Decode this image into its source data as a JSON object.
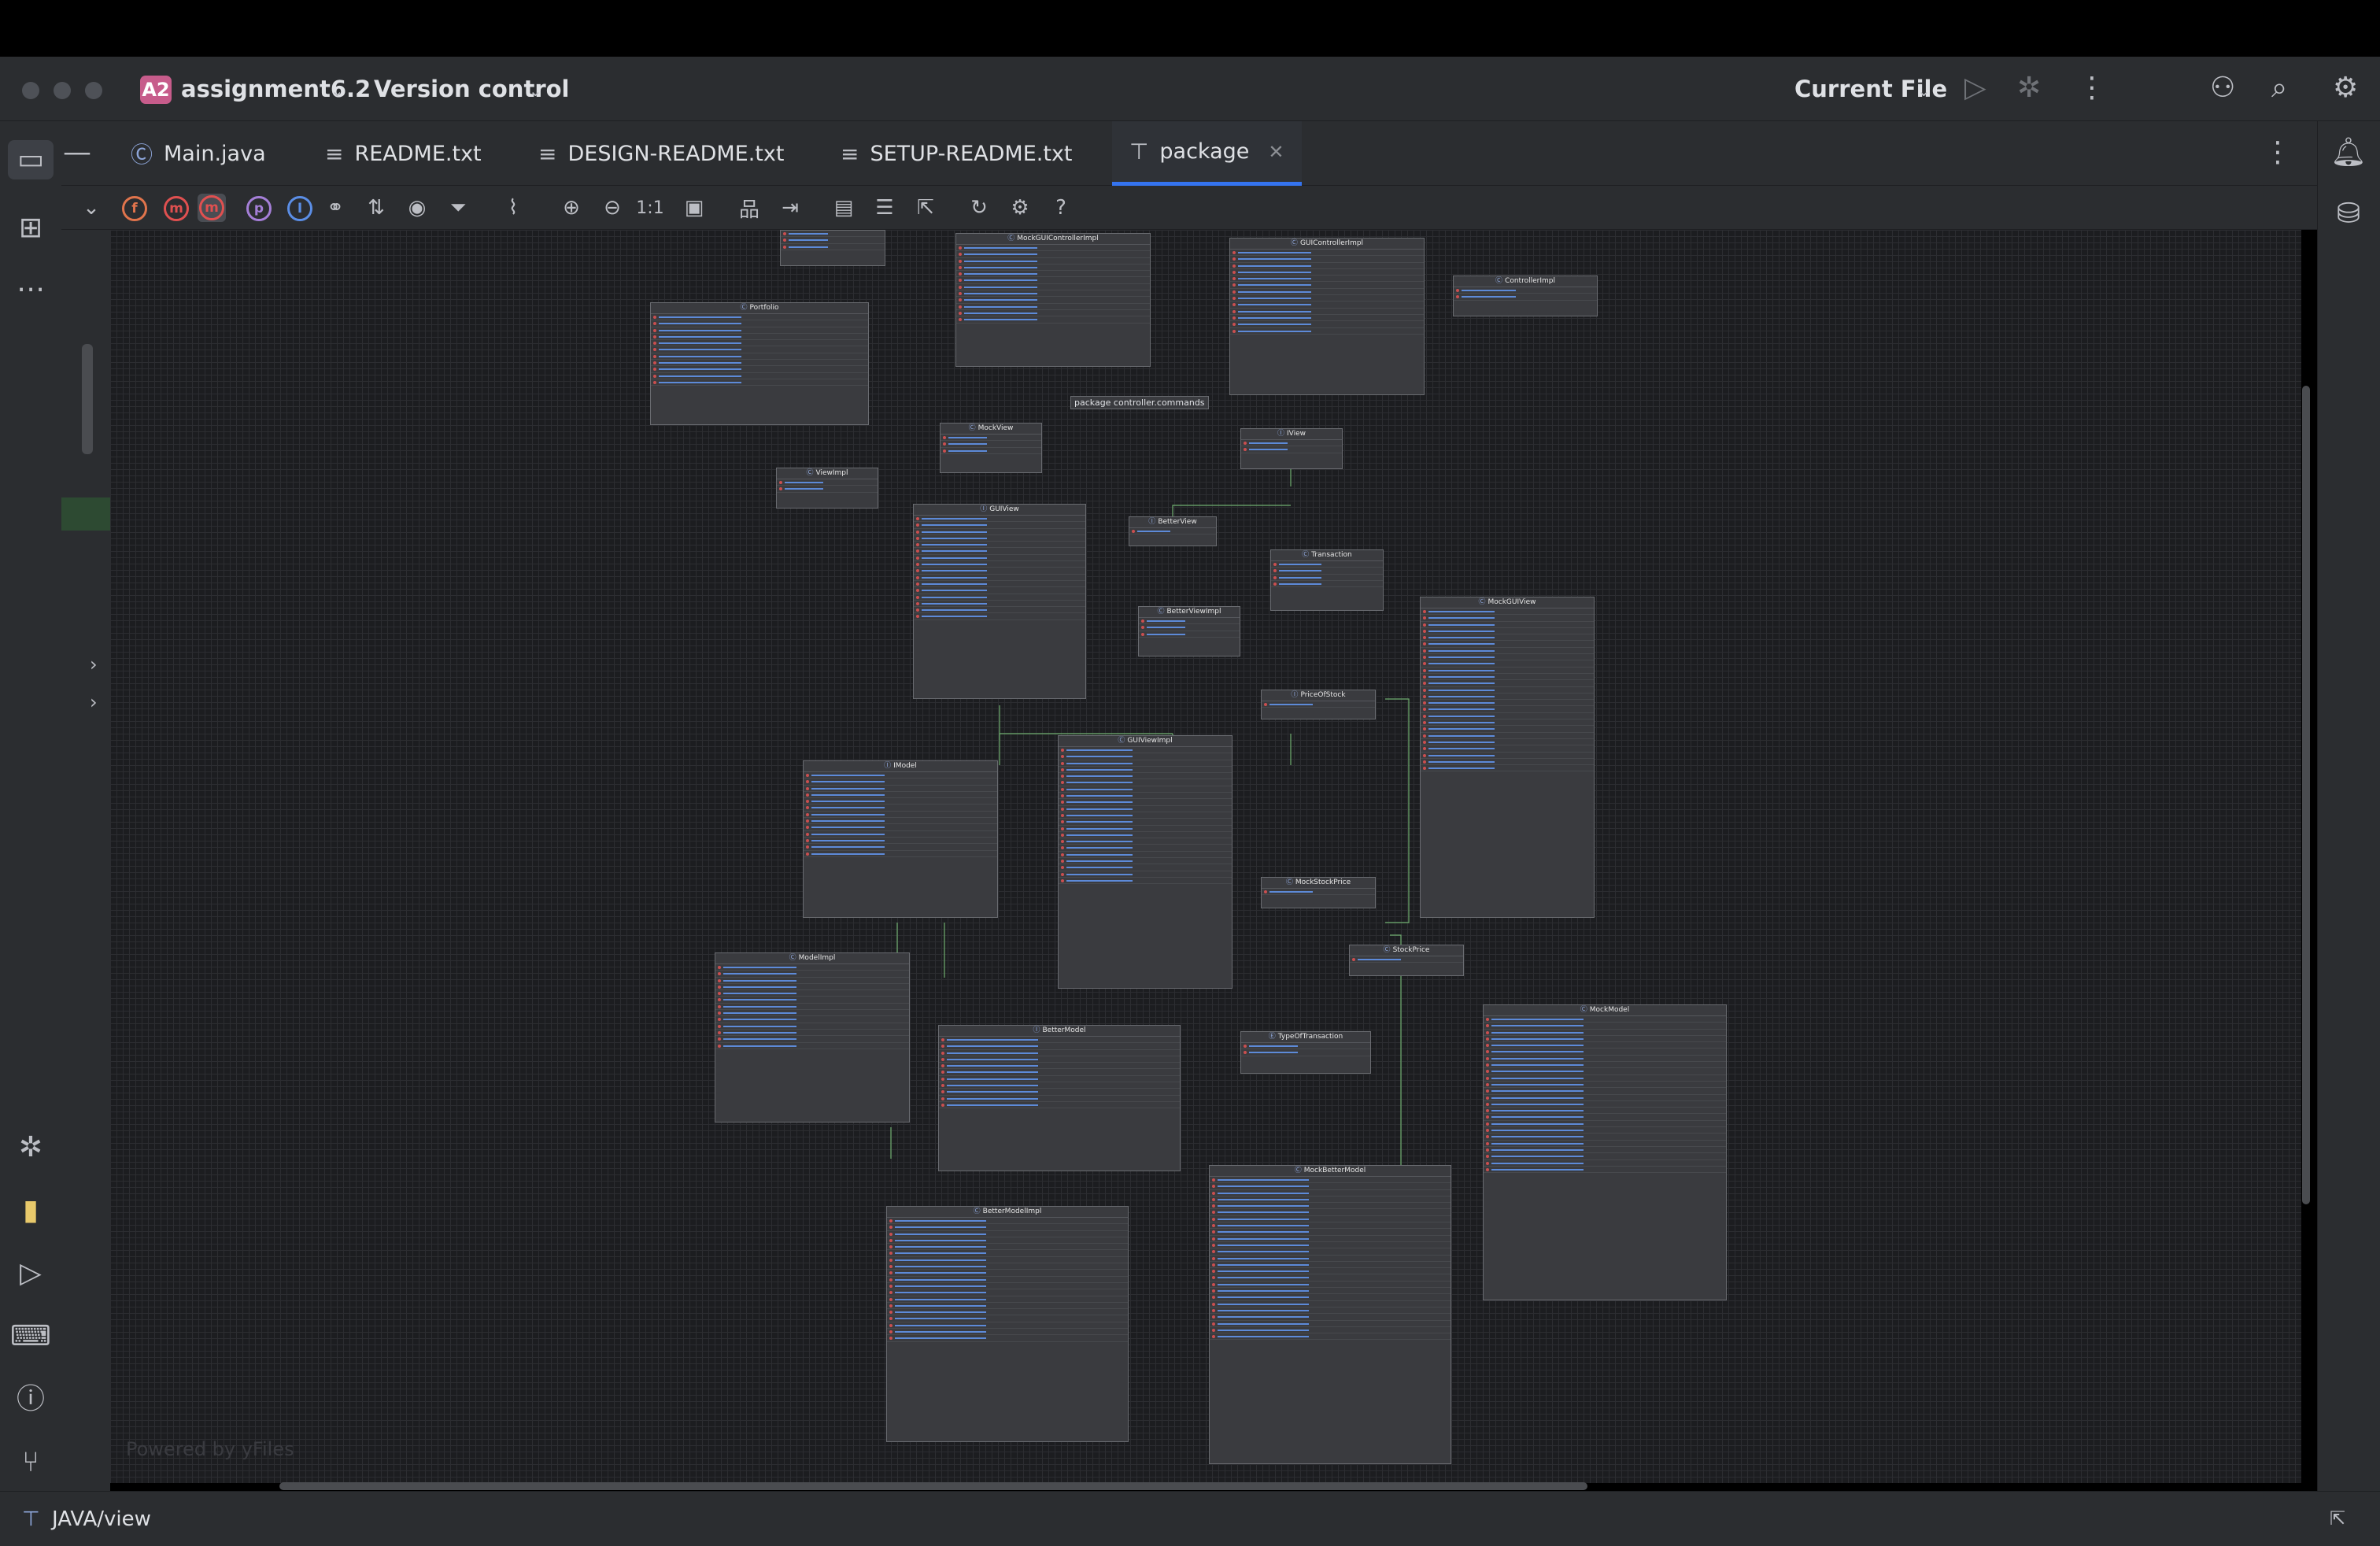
{
  "titlebar": {
    "project_badge": "A2",
    "project_name": "assignment6.2",
    "vcs_label": "Version control",
    "run_config": "Current File"
  },
  "tabs": [
    {
      "label": "Main.java",
      "icon": "java-class-icon",
      "active": false
    },
    {
      "label": "README.txt",
      "icon": "text-file-icon",
      "active": false
    },
    {
      "label": "DESIGN-README.txt",
      "icon": "text-file-icon",
      "active": false
    },
    {
      "label": "SETUP-README.txt",
      "icon": "text-file-icon",
      "active": false
    },
    {
      "label": "package",
      "icon": "diagram-icon",
      "active": true
    }
  ],
  "toolbar": {
    "fit_label": "1:1",
    "help_glyph": "?"
  },
  "diagram": {
    "nodes": [
      {
        "title": "MockGUIControllerImpl",
        "rows": 12
      },
      {
        "title": "GUIControllerImpl",
        "rows": 13
      },
      {
        "title": "ControllerImpl",
        "rows": 2
      },
      {
        "title": "Portfolio",
        "rows": 11
      },
      {
        "title": "MockView",
        "rows": 3
      },
      {
        "title": "IView",
        "rows": 2
      },
      {
        "title": "ViewImpl",
        "rows": 2
      },
      {
        "title": "GUIView",
        "rows": 16
      },
      {
        "title": "BetterView",
        "rows": 1
      },
      {
        "title": "Transaction",
        "rows": 4
      },
      {
        "title": "BetterViewImpl",
        "rows": 3
      },
      {
        "title": "MockGUIView",
        "rows": 25
      },
      {
        "title": "PriceOfStock",
        "rows": 1
      },
      {
        "title": "IModel",
        "rows": 13
      },
      {
        "title": "GUIViewImpl",
        "rows": 21
      },
      {
        "title": "MockStockPrice",
        "rows": 1
      },
      {
        "title": "StockPrice",
        "rows": 1
      },
      {
        "title": "ModelImpl",
        "rows": 13
      },
      {
        "title": "MockModel",
        "rows": 24
      },
      {
        "title": "TypeOfTransaction",
        "rows": 2
      },
      {
        "title": "BetterModel",
        "rows": 11
      },
      {
        "title": "MockBetterModel",
        "rows": 25
      },
      {
        "title": "BetterModelImpl",
        "rows": 19
      }
    ],
    "package_label": "package controller.commands",
    "watermark": "Powered by yFiles"
  },
  "statusbar": {
    "path": "JAVA/view"
  }
}
